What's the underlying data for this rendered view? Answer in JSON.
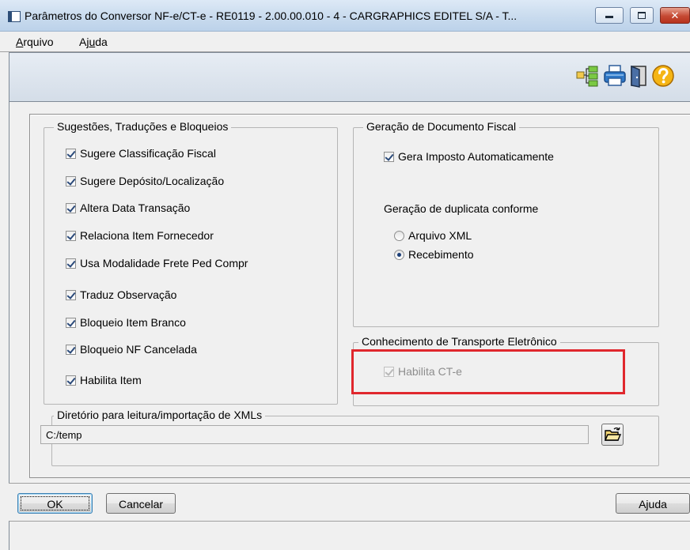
{
  "window": {
    "title": "Parâmetros do Conversor NF-e/CT-e - RE0119 - 2.00.00.010 - 4 - CARGRAPHICS EDITEL S/A - T...",
    "close_glyph": "✕"
  },
  "menu": {
    "arquivo": {
      "pre": "",
      "underline": "A",
      "post": "rquivo"
    },
    "ajuda": {
      "pre": "Aj",
      "underline": "u",
      "post": "da"
    }
  },
  "toolbar": {
    "icons": [
      "hierarchy-tree-icon",
      "printer-icon",
      "exit-door-icon",
      "help-question-icon"
    ]
  },
  "sugestoes": {
    "legend": "Sugestões, Traduções e Bloqueios",
    "items": [
      {
        "label": "Sugere Classificação Fiscal",
        "checked": true
      },
      {
        "label": "Sugere Depósito/Localização",
        "checked": true
      },
      {
        "label": "Altera Data Transação",
        "checked": true
      },
      {
        "label": "Relaciona Item Fornecedor",
        "checked": true
      },
      {
        "label": "Usa Modalidade Frete Ped Compr",
        "checked": true
      },
      {
        "label": "Traduz Observação",
        "checked": true
      },
      {
        "label": "Bloqueio Item Branco",
        "checked": true
      },
      {
        "label": "Bloqueio NF Cancelada",
        "checked": true
      },
      {
        "label": "Habilita Item",
        "checked": true
      }
    ]
  },
  "geracao": {
    "legend": "Geração de Documento Fiscal",
    "gera_imposto": {
      "label": "Gera Imposto Automaticamente",
      "checked": true
    },
    "duplicata_label": "Geração de duplicata conforme",
    "radios": [
      {
        "label": "Arquivo XML",
        "selected": false
      },
      {
        "label": "Recebimento",
        "selected": true
      }
    ]
  },
  "cte": {
    "legend": "Conhecimento de Transporte Eletrônico",
    "habilita": {
      "label": "Habilita CT-e",
      "checked": true,
      "disabled": true
    }
  },
  "diretorio": {
    "legend": "Diretório para leitura/importação de XMLs",
    "value": "C:/temp"
  },
  "buttons": {
    "ok": "OK",
    "cancelar": "Cancelar",
    "ajuda": "Ajuda"
  },
  "colors": {
    "highlight": "#e0272d",
    "titlebar": "#c9dbee",
    "close_button": "#c54933"
  }
}
